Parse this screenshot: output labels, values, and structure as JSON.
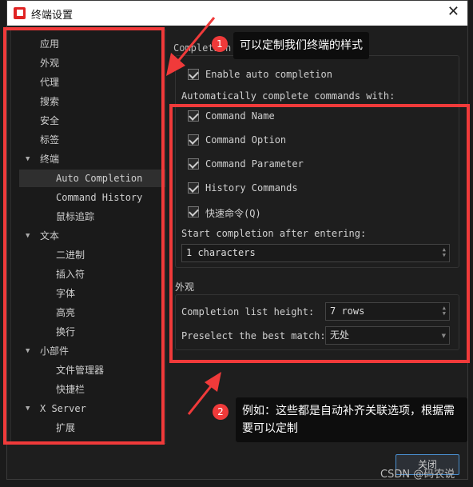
{
  "window": {
    "title": "终端设置",
    "close_label": "关闭"
  },
  "sidebar": {
    "items": [
      {
        "label": "应用"
      },
      {
        "label": "外观"
      },
      {
        "label": "代理"
      },
      {
        "label": "搜索"
      },
      {
        "label": "安全"
      },
      {
        "label": "标签"
      },
      {
        "label": "终端",
        "expanded": true
      },
      {
        "label": "Auto Completion",
        "selected": true
      },
      {
        "label": "Command History"
      },
      {
        "label": "鼠标追踪"
      },
      {
        "label": "文本",
        "expanded": true
      },
      {
        "label": "二进制"
      },
      {
        "label": "插入符"
      },
      {
        "label": "字体"
      },
      {
        "label": "高亮"
      },
      {
        "label": "换行"
      },
      {
        "label": "小部件",
        "expanded": true
      },
      {
        "label": "文件管理器"
      },
      {
        "label": "快捷栏"
      },
      {
        "label": "X Server",
        "expanded": true
      },
      {
        "label": "扩展"
      }
    ]
  },
  "completion": {
    "group_title": "Completion",
    "enable": {
      "label": "Enable auto completion",
      "checked": true
    },
    "commands_heading": "Automatically complete commands with:",
    "options": [
      {
        "label": "Command Name",
        "checked": true
      },
      {
        "label": "Command Option",
        "checked": true
      },
      {
        "label": "Command Parameter",
        "checked": true
      },
      {
        "label": "History Commands",
        "checked": true
      },
      {
        "label": "快速命令(Q)",
        "checked": true
      }
    ],
    "start_label": "Start completion after entering:",
    "start_value": "1 characters"
  },
  "appearance": {
    "group_title": "外观",
    "height_label": "Completion list height:",
    "height_value": "7 rows",
    "preselect_label": "Preselect the best match:",
    "preselect_value": "无处"
  },
  "annotations": [
    {
      "number": "1",
      "text": "可以定制我们终端的样式"
    },
    {
      "number": "2",
      "text": "例如：这些都是自动补齐关联选项，根据需要可以定制"
    }
  ],
  "watermark": "CSDN @码农说",
  "colors": {
    "annotation": "#f03a3a",
    "accent": "#4a8fd0"
  }
}
